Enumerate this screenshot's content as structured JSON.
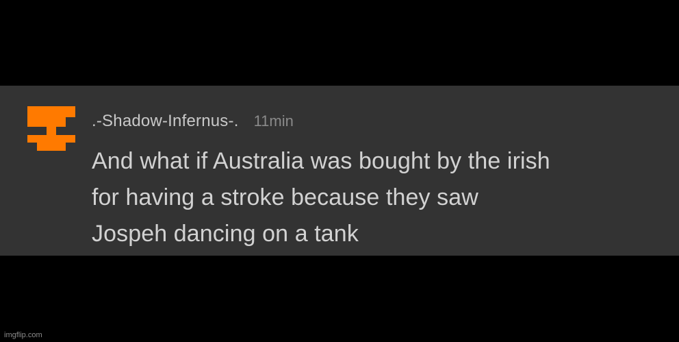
{
  "comment": {
    "avatar_icon": "pixel-face-icon",
    "avatar_color": "#ff7a00",
    "username": ".-Shadow-Infernus-.",
    "timestamp": "11min",
    "text": "And what if Australia was bought by the irish\nfor having a stroke because they saw\nJospeh dancing on a tank"
  },
  "watermark": {
    "text": "imgflip.com"
  },
  "colors": {
    "background": "#000000",
    "card": "#333333",
    "username": "#c8c8c8",
    "timestamp": "#8a8a8a",
    "body_text": "#d2d2d2"
  }
}
